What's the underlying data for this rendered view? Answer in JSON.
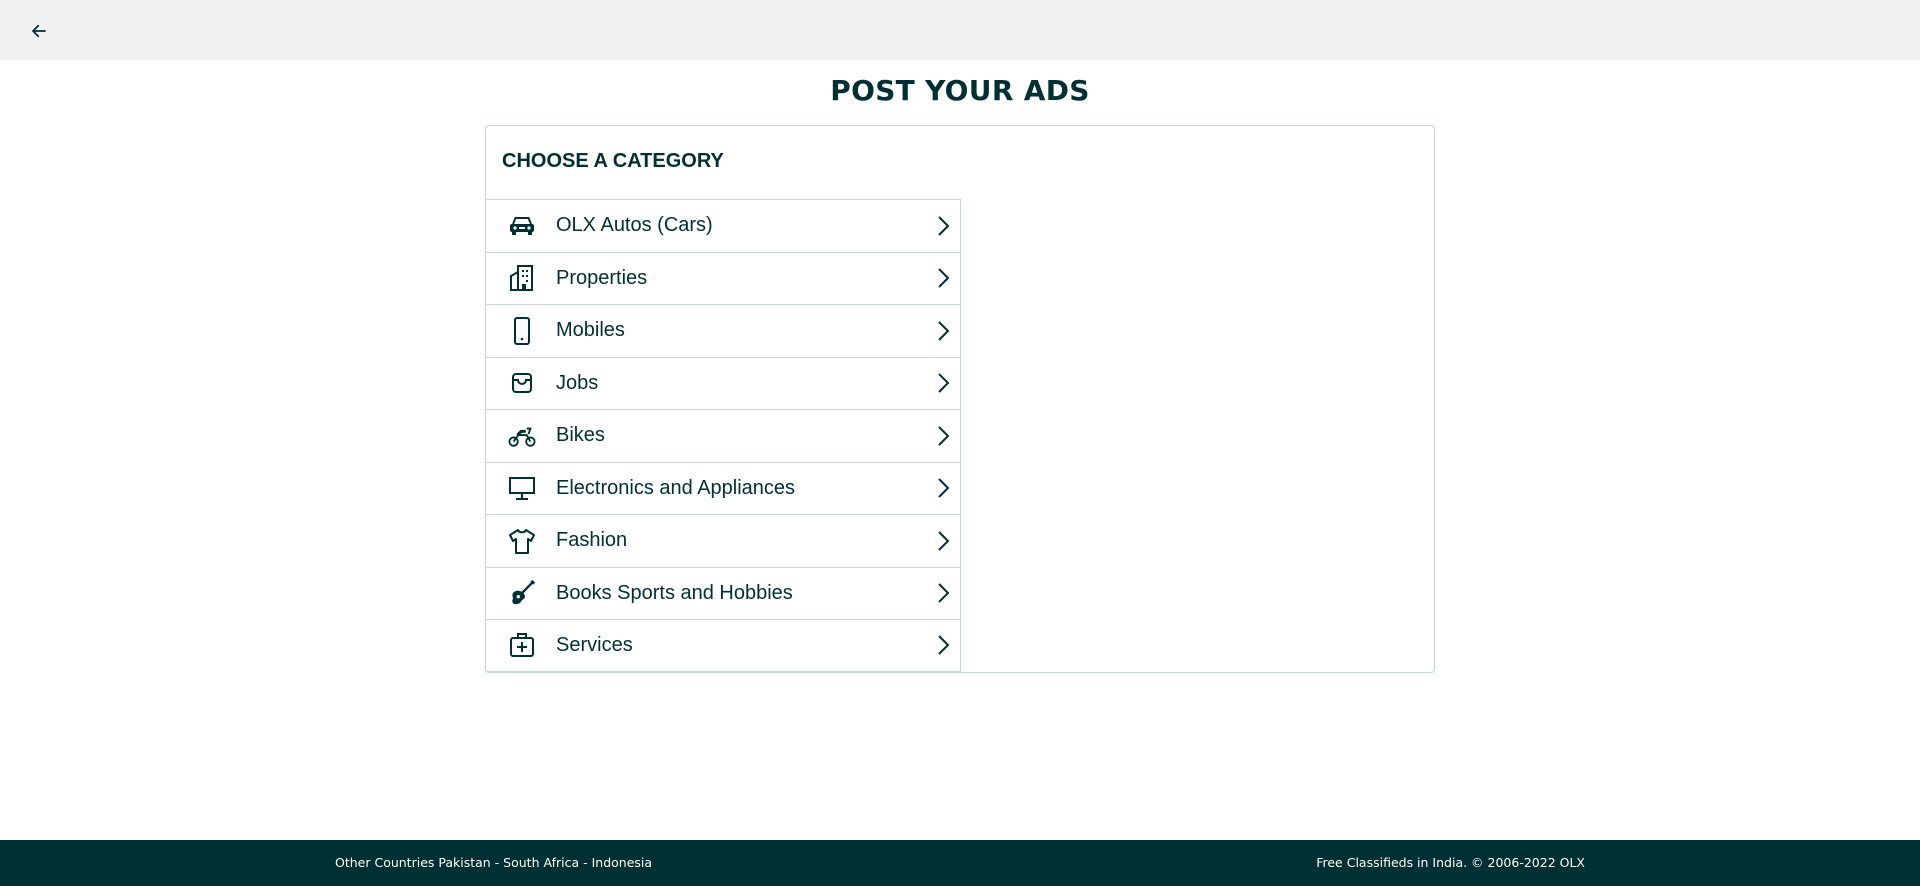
{
  "header": {
    "back_icon": "arrow-left-icon"
  },
  "page": {
    "title": "POST YOUR ADS"
  },
  "card": {
    "heading": "CHOOSE A CATEGORY",
    "categories": [
      {
        "label": "OLX Autos (Cars)",
        "icon": "car-icon"
      },
      {
        "label": "Properties",
        "icon": "building-icon"
      },
      {
        "label": "Mobiles",
        "icon": "mobile-phone-icon"
      },
      {
        "label": "Jobs",
        "icon": "inbox-tray-icon"
      },
      {
        "label": "Bikes",
        "icon": "motorbike-icon"
      },
      {
        "label": "Electronics and Appliances",
        "icon": "monitor-icon"
      },
      {
        "label": "Fashion",
        "icon": "tshirt-icon"
      },
      {
        "label": "Books Sports and Hobbies",
        "icon": "guitar-icon"
      },
      {
        "label": "Services",
        "icon": "medical-bag-icon"
      }
    ]
  },
  "footer": {
    "left_text": "Other Countries Pakistan - South Africa - Indonesia",
    "right_text": "Free Classifieds in India. © 2006-2022 OLX"
  },
  "colors": {
    "primary": "#002f34",
    "topbar_bg": "#eff1f3",
    "border": "#ccd5d6",
    "footer_bg": "#002f34"
  }
}
